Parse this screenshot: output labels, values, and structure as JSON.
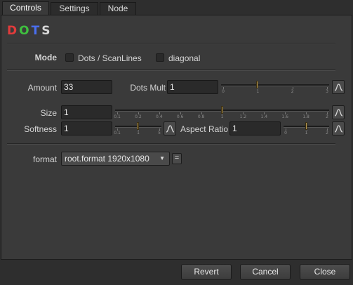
{
  "tabs": [
    {
      "label": "Controls",
      "active": true
    },
    {
      "label": "Settings",
      "active": false
    },
    {
      "label": "Node",
      "active": false
    }
  ],
  "logo": {
    "letters": [
      {
        "char": "D",
        "color": "#e23b3b"
      },
      {
        "char": "O",
        "color": "#3fbf3f"
      },
      {
        "char": "T",
        "color": "#4a6ff0"
      },
      {
        "char": "S",
        "color": "#d8d8d8"
      }
    ]
  },
  "mode": {
    "label": "Mode",
    "options": [
      {
        "label": "Dots / ScanLines",
        "checked": false
      },
      {
        "label": "diagonal",
        "checked": false
      }
    ]
  },
  "amount": {
    "label": "Amount",
    "value": "33"
  },
  "dots_mult": {
    "label": "Dots Mult",
    "value": "1",
    "slider": {
      "min": 0,
      "max": 3,
      "value": 1,
      "ticks": [
        "0",
        "1",
        "2",
        "3"
      ]
    }
  },
  "size": {
    "label": "Size",
    "value": "1",
    "slider": {
      "min": 0,
      "max": 2,
      "value": 1,
      "ticks": [
        "0.1",
        "0.2",
        "0.4",
        "0.6",
        "0.8",
        "1",
        "1.2",
        "1.4",
        "1.6",
        "1.8",
        "2"
      ]
    }
  },
  "softness": {
    "label": "Softness",
    "value": "1",
    "slider": {
      "min": 0.1,
      "max": 5,
      "value": 1,
      "ticks": [
        "0.1",
        "1",
        "5"
      ]
    }
  },
  "aspect_ratio": {
    "label": "Aspect Ratio",
    "value": "1",
    "slider": {
      "min": 0,
      "max": 2,
      "value": 1,
      "ticks": [
        "0",
        "1",
        "2"
      ]
    }
  },
  "format": {
    "label": "format",
    "selected": "root.format 1920x1080",
    "equals_button": "="
  },
  "footer": {
    "revert": "Revert",
    "cancel": "Cancel",
    "close": "Close"
  },
  "colors": {
    "panel_bg": "#3a3a3a",
    "field_bg": "#2a2a2a",
    "slider_handle": "#b89a52"
  },
  "icons": {
    "curve": "curve-editor-icon",
    "dropdown": "chevron-down-icon"
  }
}
